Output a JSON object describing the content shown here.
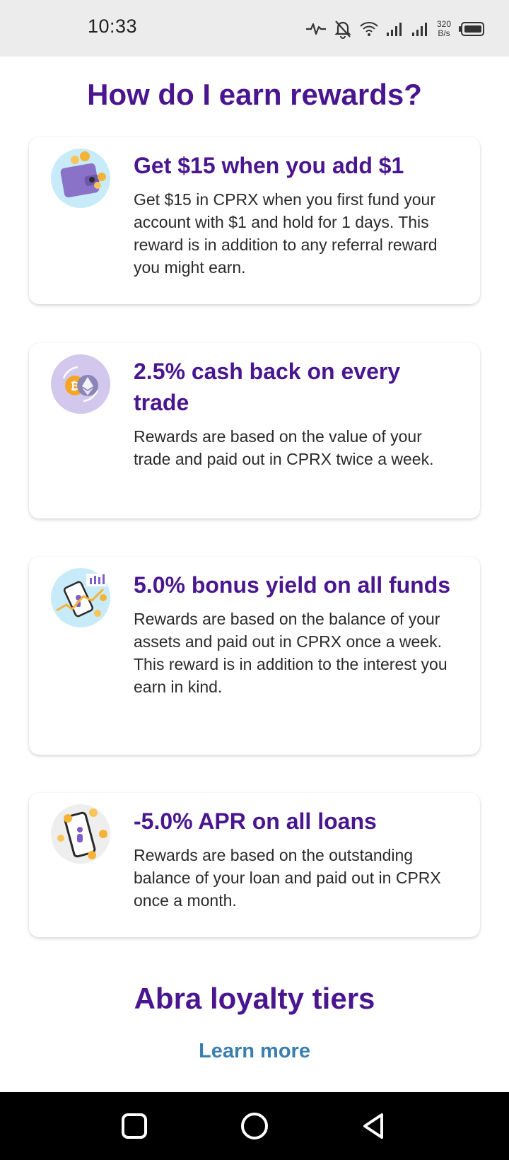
{
  "status_bar": {
    "time": "10:33",
    "net_speed_value": "320",
    "net_speed_unit": "B/s",
    "icons": [
      "activity-icon",
      "bell-off-icon",
      "wifi-icon",
      "signal-icon",
      "signal-icon",
      "battery-icon"
    ]
  },
  "page_title": "How do I earn rewards?",
  "rewards": [
    {
      "title": "Get $15 when you add $1",
      "description": "Get $15 in CPRX when you first fund your account with $1 and hold for 1 days. This reward is in addition to any referral reward you might earn.",
      "icon": "wallet-coins-icon"
    },
    {
      "title": "2.5% cash back on every trade",
      "description": "Rewards are based on the value of your trade and paid out in CPRX twice a week.",
      "icon": "crypto-exchange-icon"
    },
    {
      "title": "5.0% bonus yield on all funds",
      "description": "Rewards are based on the balance of your assets and paid out in CPRX once a week. This reward is in addition to the interest you earn in kind.",
      "icon": "phone-growth-icon"
    },
    {
      "title": "-5.0% APR on all loans",
      "description": "Rewards are based on the outstanding balance of your loan and paid out in CPRX once a month.",
      "icon": "phone-coins-icon"
    }
  ],
  "loyalty": {
    "title": "Abra loyalty tiers",
    "link_label": "Learn more"
  },
  "colors": {
    "heading": "#4a1690",
    "link": "#3a7fb0",
    "body_text": "#2a2a2a"
  },
  "nav_bar": {
    "buttons": [
      "recents-square-icon",
      "home-circle-icon",
      "back-triangle-icon"
    ]
  }
}
